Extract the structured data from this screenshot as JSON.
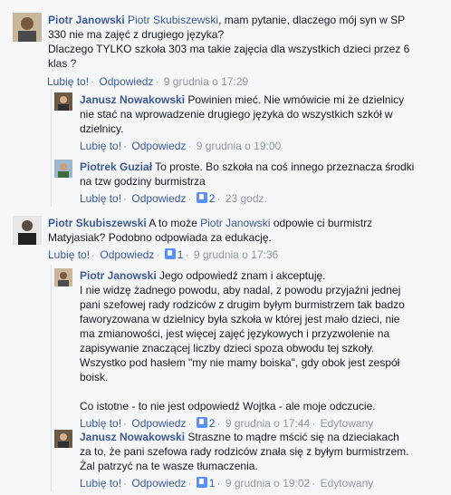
{
  "comments": [
    {
      "author": "Piotr Janowski",
      "mention": "Piotr Skubiszewski",
      "lines": [
        ", mam pytanie, dlaczego mój syn w SP",
        "330 nie ma zajęć z drugiego języka?",
        "Dlaczego TYLKO szkoła 303 ma takie zajęcia dla wszystkich dzieci przez 6",
        "klas ?"
      ],
      "like": "Lubię to!",
      "reply": "Odpowiedz",
      "time": "9 grudnia o 17:29"
    },
    {
      "author": "Janusz Nowakowski",
      "lines": [
        "Powinien mieć. Nie wmówicie mi że dzielnicy",
        "nie stać na wprowadzenie drugiego języka do wszystkich szkół w",
        "dzielnicy."
      ],
      "like": "Lubię to!",
      "reply": "Odpowiedz",
      "time": "9 grudnia o 19:00"
    },
    {
      "author": "Piotrek Guział",
      "lines": [
        "To proste. Bo szkoła na coś innego przeznacza środki",
        "na tzw godziny burmistrza"
      ],
      "like": "Lubię to!",
      "reply": "Odpowiedz",
      "likes": "2",
      "time": "23 godz."
    },
    {
      "author": "Piotr Skubiszewski",
      "text_a": "A to może",
      "mention": "Piotr Janowski",
      "text_b": "odpowie ci burmistrz",
      "lines": [
        "Matyjasiak? Podobno odpowiada za edukację."
      ],
      "like": "Lubię to!",
      "reply": "Odpowiedz",
      "likes": "1",
      "time": "9 grudnia o 17:36"
    },
    {
      "author": "Piotr Janowski",
      "lines": [
        "Jego odpowiedź znam i akceptuję.",
        "I nie widzę żadnego powodu, aby nadal, z powodu przyjaźni jednej",
        "pani szefowej rady rodziców z drugim byłym burmistrzem tak badzo",
        "faworyzowana w dzielnicy była szkoła w której jest mało dzieci, nie",
        "ma zmianowości, jest więcej zajęć językowych i przyzwolenie na",
        "zapisywanie znaczącej liczby dzieci spoza obwodu tej szkoły.",
        "Wszystko pod hasłem \"my nie mamy boiska\", gdy obok jest zespół",
        "boisk.",
        "",
        "Co istotne - to nie jest odpowiedź Wojtka - ale moje odczucie."
      ],
      "like": "Lubię to!",
      "reply": "Odpowiedz",
      "likes": "2",
      "time": "9 grudnia o 17:44",
      "edited": "Edytowany"
    },
    {
      "author": "Janusz Nowakowski",
      "lines": [
        "Straszne to mądre mścić się na dzieciakach",
        "za to, że pani szefowa rady rodziców znała się z byłym burmistrzem.",
        "Żal patrzyć na te wasze tłumaczenia."
      ],
      "like": "Lubię to!",
      "reply": "Odpowiedz",
      "likes": "1",
      "time": "9 grudnia o 19:02",
      "edited": "Edytowany"
    }
  ]
}
